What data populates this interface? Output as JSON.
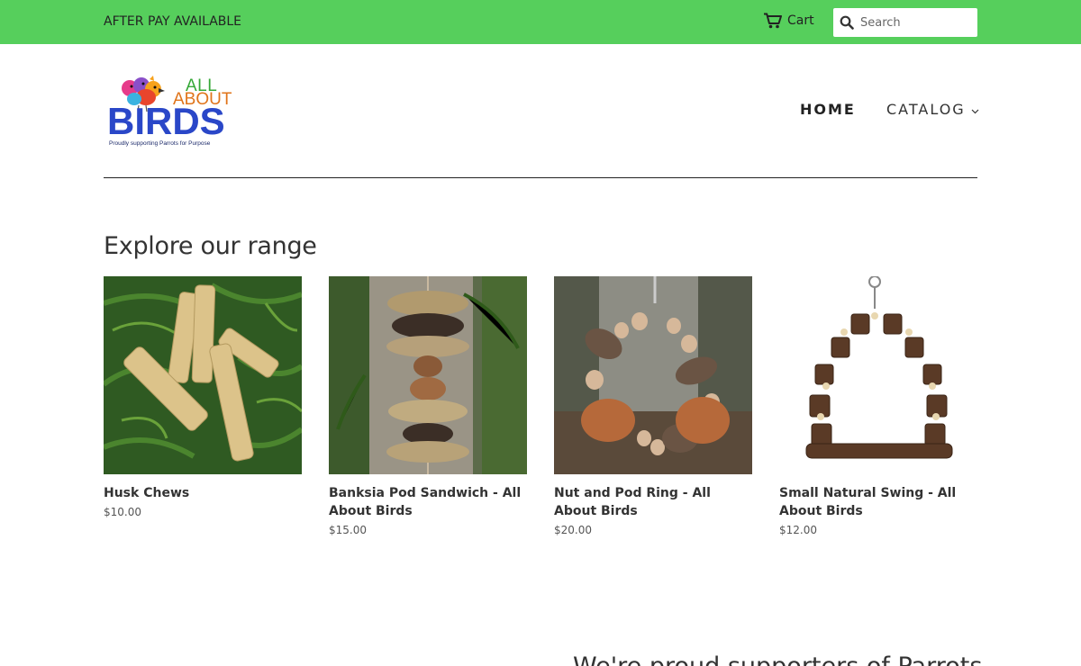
{
  "topbar": {
    "promo": "AFTER PAY AVAILABLE",
    "cart_label": "Cart",
    "search_placeholder": "Search",
    "background": "#56cf5c"
  },
  "logo": {
    "line1": "ALL",
    "line2": "ABOUT",
    "line3": "BIRDS",
    "tagline": "Proudly supporting Parrots for Purpose"
  },
  "nav": {
    "home": "HOME",
    "catalog": "CATALOG"
  },
  "section": {
    "title": "Explore our range"
  },
  "products": [
    {
      "name": "Husk Chews",
      "price": "$10.00"
    },
    {
      "name": "Banksia Pod Sandwich - All About Birds",
      "price": "$15.00"
    },
    {
      "name": "Nut and Pod Ring - All About Birds",
      "price": "$20.00"
    },
    {
      "name": "Small Natural Swing - All About Birds",
      "price": "$12.00"
    }
  ],
  "footer_partial": {
    "heading": "We're proud supporters of Parrots"
  },
  "icons": {
    "cart": "cart-icon",
    "search": "search-icon",
    "catalog_caret": "chevron-down-icon"
  }
}
